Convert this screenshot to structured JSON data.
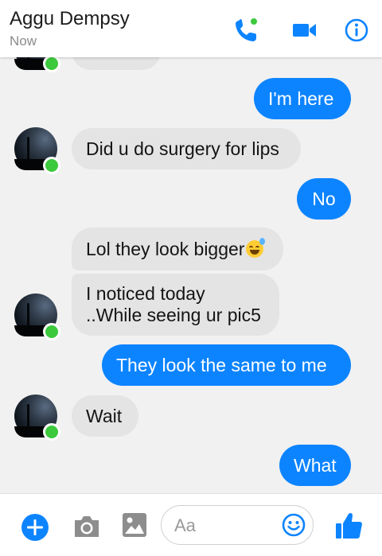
{
  "header": {
    "contact_name": "Aggu Dempsy",
    "status": "Now",
    "icons": [
      "phone-icon",
      "video-call-icon",
      "info-icon"
    ]
  },
  "messages": [
    {
      "direction": "incoming",
      "text": ""
    },
    {
      "direction": "outgoing",
      "text": "I'm here"
    },
    {
      "direction": "incoming",
      "text": "Did u do surgery for lips"
    },
    {
      "direction": "outgoing",
      "text": "No"
    },
    {
      "direction": "incoming",
      "text": "Lol they look bigger",
      "emoji": "sweat-smile-emoji"
    },
    {
      "direction": "incoming",
      "lines": [
        "I noticed today",
        "..While seeing ur pic5"
      ]
    },
    {
      "direction": "outgoing",
      "text": "They look the same to me"
    },
    {
      "direction": "incoming",
      "text": "Wait"
    },
    {
      "direction": "outgoing",
      "text": "What"
    }
  ],
  "composer": {
    "placeholder": "Aa",
    "icons": [
      "plus-icon",
      "camera-icon",
      "image-icon",
      "emoji-icon",
      "like-icon"
    ]
  },
  "colors": {
    "accent": "#0d84ff",
    "incoming_bubble": "#e4e4e4",
    "online": "#3cc93c"
  }
}
